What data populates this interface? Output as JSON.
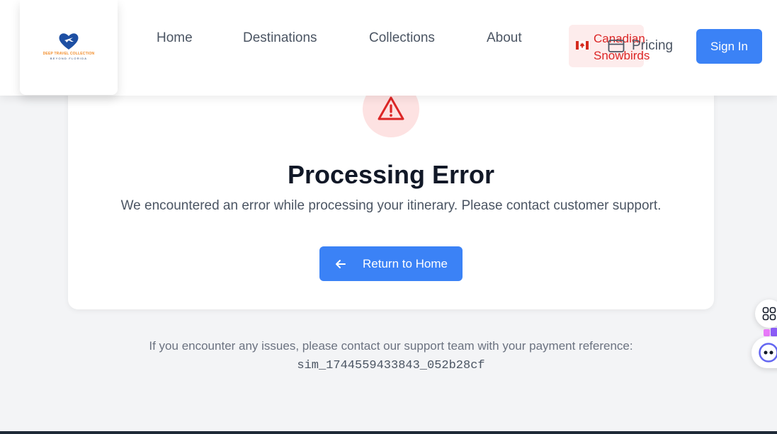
{
  "header": {
    "logo": {
      "line1": "DEEP TRAVEL COLLECTION",
      "line2": "BEYOND FLORIDA",
      "icon": "heart-plane-logo"
    },
    "nav": {
      "home": "Home",
      "destinations": "Destinations",
      "collections": "Collections",
      "about": "About"
    },
    "snowbirds": {
      "line1": "Canadian",
      "line2": "Snowbirds",
      "icon": "canada-flag-icon"
    },
    "pricing": {
      "label": "Pricing",
      "icon": "credit-card-icon"
    },
    "sign_in": "Sign In"
  },
  "error": {
    "icon": "warning-triangle-icon",
    "title": "Processing Error",
    "message": "We encountered an error while processing your itinerary. Please contact customer support.",
    "button_label": "Return to Home",
    "button_icon": "arrow-left-icon"
  },
  "support": {
    "text": "If you encounter any issues, please contact our support team with your payment reference:",
    "reference": "sim_1744559433843_052b28cf"
  },
  "colors": {
    "accent": "#3b82f6",
    "error": "#dc2626",
    "error_bg": "#fde2e2",
    "snowbird_bg": "#fdecec"
  }
}
